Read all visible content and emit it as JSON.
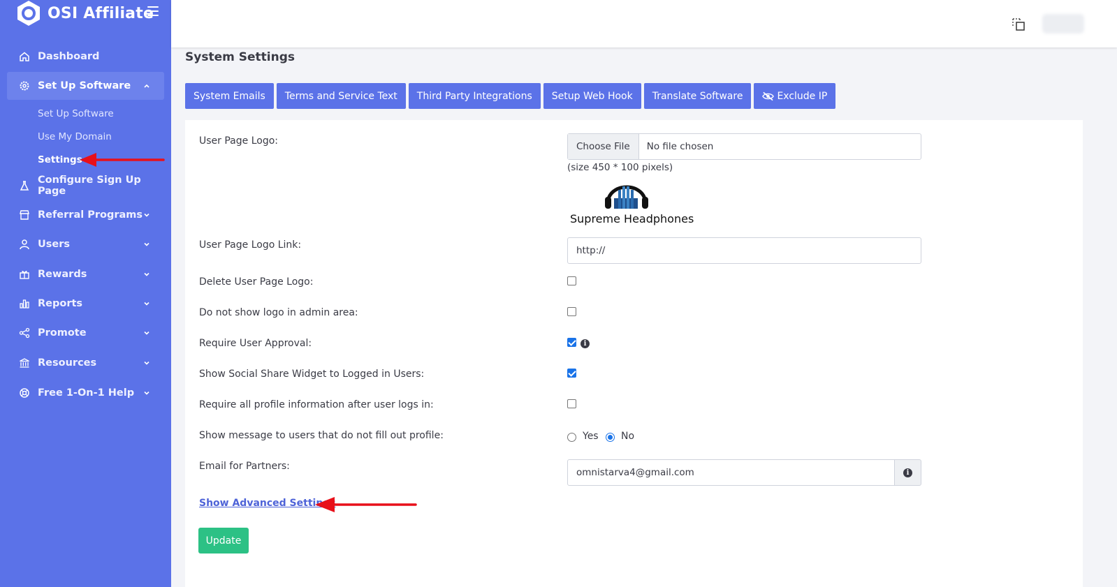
{
  "brand": {
    "name": "OSI Affiliate"
  },
  "sidebar": {
    "items": [
      {
        "label": "Dashboard",
        "icon": "home-icon"
      },
      {
        "label": "Set Up Software",
        "icon": "gear-icon",
        "expanded": true
      },
      {
        "label": "Configure Sign Up Page",
        "icon": "flask-icon"
      },
      {
        "label": "Referral Programs",
        "icon": "store-icon"
      },
      {
        "label": "Users",
        "icon": "user-icon"
      },
      {
        "label": "Rewards",
        "icon": "gift-icon"
      },
      {
        "label": "Reports",
        "icon": "bar-chart-icon"
      },
      {
        "label": "Promote",
        "icon": "share-icon"
      },
      {
        "label": "Resources",
        "icon": "bank-icon"
      },
      {
        "label": "Free 1-On-1 Help",
        "icon": "lifebuoy-icon"
      }
    ],
    "sub_items": [
      {
        "label": "Set Up Software"
      },
      {
        "label": "Use My Domain"
      },
      {
        "label": "Settings",
        "current": true
      }
    ]
  },
  "page": {
    "title": "System Settings"
  },
  "tabs": [
    {
      "label": "System Emails"
    },
    {
      "label": "Terms and Service Text"
    },
    {
      "label": "Third Party Integrations"
    },
    {
      "label": "Setup Web Hook"
    },
    {
      "label": "Translate Software"
    },
    {
      "label": "Exclude IP",
      "icon": "eye-slash-icon"
    }
  ],
  "form": {
    "logo_label": "User Page Logo:",
    "file_button": "Choose File",
    "file_status": "No file chosen",
    "size_hint": "(size 450 * 100 pixels)",
    "logo_caption": "Supreme Headphones",
    "logo_link_label": "User Page Logo Link:",
    "logo_link_value": "http://",
    "delete_logo_label": "Delete User Page Logo:",
    "delete_logo_checked": false,
    "hide_logo_admin_label": "Do not show logo in admin area:",
    "hide_logo_admin_checked": false,
    "require_approval_label": "Require User Approval:",
    "require_approval_checked": true,
    "social_widget_label": "Show Social Share Widget to Logged in Users:",
    "social_widget_checked": true,
    "require_profile_label": "Require all profile information after user logs in:",
    "require_profile_checked": false,
    "profile_message_label": "Show message to users that do not fill out profile:",
    "radio_yes": "Yes",
    "radio_no": "No",
    "radio_selected": "No",
    "partner_email_label": "Email for Partners:",
    "partner_email_value": "omnistarva4@gmail.com",
    "advanced_link": "Show Advanced Settings",
    "update_button": "Update"
  },
  "colors": {
    "sidebar": "#5b72e8",
    "tab": "#5b72e8",
    "update": "#2cc185",
    "link": "#4e63d8",
    "annotation_arrow": "#e8101a"
  }
}
